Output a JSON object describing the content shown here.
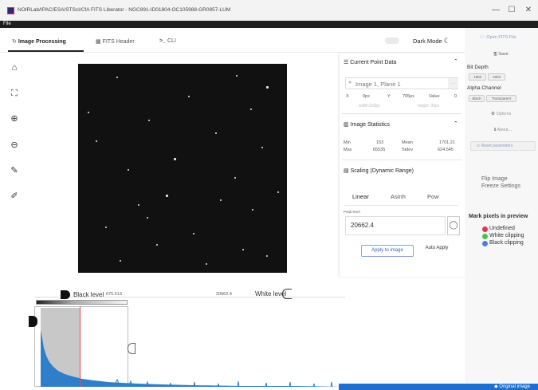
{
  "window": {
    "title": "NOIRLab/IPAC/ESA/STScI/CfA FITS Liberator - NGC891-ID01804-OC105988-GR0957-LUM",
    "controls": [
      "—",
      "☐",
      "✕"
    ]
  },
  "menu": {
    "file": "File"
  },
  "tabs": [
    {
      "icon": "↻",
      "label": "Image Processing"
    },
    {
      "icon": "▦",
      "label": "FITS Header"
    },
    {
      "icon": ">_",
      "label": "CLI"
    }
  ],
  "dark_mode": {
    "label": "Dark Mode",
    "icon": "☾"
  },
  "toolbar": [
    "⌂",
    "⛶",
    "⊕",
    "⊖",
    "✎",
    "✐"
  ],
  "histogram": {
    "black_label": "Black level",
    "black_value": "675.513",
    "white_value": "20662.4",
    "white_label": "White level"
  },
  "current_point": {
    "title": "Current Point Data",
    "plane": "Image 1, Plane 1",
    "more": "...",
    "x_label": "X",
    "x_value": "0px",
    "y_label": "Y",
    "y_value": "705px",
    "value_label": "Value",
    "value": "0",
    "width": "width:225px",
    "height": "height: 00px"
  },
  "stats": {
    "title": "Image Statistics",
    "min_label": "Min",
    "min": "153",
    "max_label": "Max",
    "max": "65535",
    "mean_label": "Mean",
    "mean": "1701.21",
    "stdev_label": "Stdev",
    "stdev": "624.545"
  },
  "scaling": {
    "title": "Scaling (Dynamic Range)",
    "tabs": [
      "Linear",
      "Asinh",
      "Pow"
    ],
    "peak_label": "Peak level",
    "peak_value": "20662.4",
    "apply_label": "Apply to image",
    "auto_apply": "Auto Apply"
  },
  "side": {
    "open": "Open FITS File",
    "save": "Save",
    "bit_depth": "Bit Depth",
    "bit_options": [
      "16bit",
      "32bit"
    ],
    "alpha": "Alpha Channel",
    "alpha_options": [
      "Black",
      "Transparent"
    ],
    "options": "Options",
    "about": "About...",
    "reset": "Reset parameters",
    "flip": "Flip Image",
    "freeze": "Freeze Settings",
    "mark_title": "Mark pixels in preview",
    "marks": [
      {
        "label": "Undefined",
        "color": "#e8344a"
      },
      {
        "label": "White clipping",
        "color": "#4cc04f"
      },
      {
        "label": "Black clipping",
        "color": "#4a7fe0"
      }
    ]
  },
  "status": {
    "label": "Original image"
  }
}
